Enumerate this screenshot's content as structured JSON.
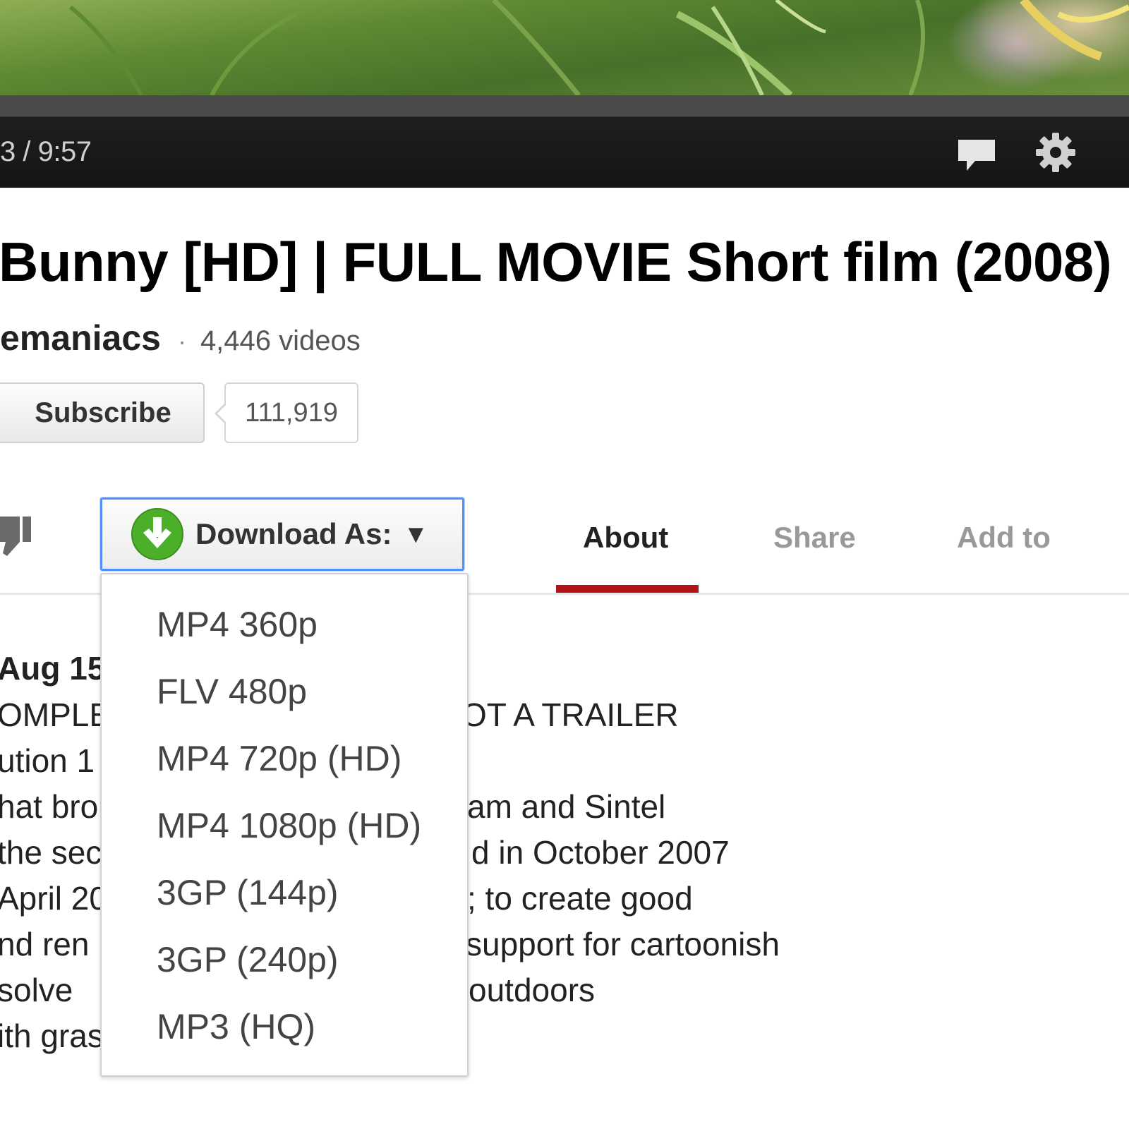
{
  "player": {
    "time_display": "3 / 9:57",
    "icons": [
      "captions-icon",
      "gear-icon"
    ]
  },
  "video": {
    "title": "Bunny [HD] | FULL MOVIE Short film (2008)",
    "channel_name": "emaniacs",
    "separator": "·",
    "video_count": "4,446 videos"
  },
  "subscribe": {
    "label": "Subscribe",
    "count": "111,919"
  },
  "actions": {
    "download_label": "Download As:",
    "download_caret": "▼",
    "tabs": [
      {
        "label": "About",
        "active": true
      },
      {
        "label": "Share",
        "active": false
      },
      {
        "label": "Add to",
        "active": false
      }
    ]
  },
  "download_menu": {
    "options": [
      "MP4 360p",
      "FLV 480p",
      "MP4 720p (HD)",
      "MP4 1080p (HD)",
      "3GP (144p)",
      "3GP (240p)",
      "MP3 (HQ)"
    ]
  },
  "description": {
    "date": "Aug 15",
    "left_fragments": [
      "OMPLE",
      "ution 1",
      "hat bro",
      "the sec",
      "April 20",
      "nd ren",
      " solve",
      "ith gras"
    ],
    "right_fragments": [
      "OT A TRAILER",
      "am and Sintel",
      "d in October 2007",
      "; to create good",
      "support for cartoonish",
      "outdoors"
    ]
  },
  "colors": {
    "accent_blue": "#4d90fe",
    "tab_underline": "#b31217",
    "download_green": "#4caf2a"
  }
}
